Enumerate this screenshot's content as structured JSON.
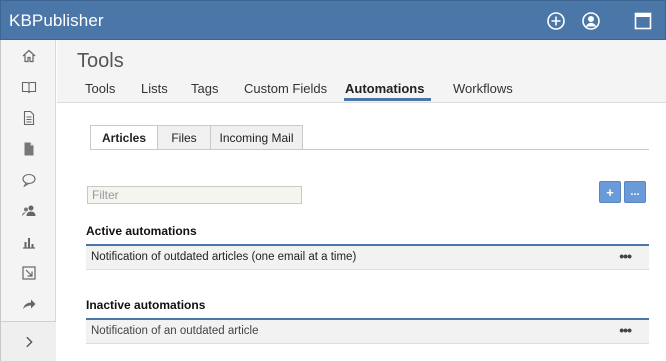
{
  "app": {
    "brand": "KBPublisher",
    "top_icons": [
      "plus-circle-icon",
      "user-circle-icon",
      "window-icon"
    ]
  },
  "sidebar": {
    "items": [
      "home-icon",
      "book-icon",
      "document-icon",
      "file-icon",
      "comments-icon",
      "users-icon",
      "chart-icon",
      "export-icon",
      "share-icon"
    ],
    "expand_icon": "chevron-right-icon"
  },
  "header": {
    "title": "Tools",
    "tabs": [
      {
        "label": "Tools"
      },
      {
        "label": "Lists"
      },
      {
        "label": "Tags"
      },
      {
        "label": "Custom Fields"
      },
      {
        "label": "Automations",
        "active": true
      },
      {
        "label": "Workflows"
      }
    ]
  },
  "subtabs": [
    {
      "label": "Articles",
      "active": true
    },
    {
      "label": "Files"
    },
    {
      "label": "Incoming Mail"
    }
  ],
  "filter": {
    "placeholder": "Filter",
    "value": ""
  },
  "buttons": {
    "add": "+",
    "more": "..."
  },
  "active_section": {
    "title": "Active automations",
    "rows": [
      {
        "text": "Notification of outdated articles (one email at a time)",
        "menu": "•••"
      }
    ]
  },
  "inactive_section": {
    "title": "Inactive automations",
    "rows": [
      {
        "text": "Notification of an outdated article",
        "menu": "•••"
      }
    ]
  },
  "colors": {
    "brand": "#4a76a8",
    "button": "#6a9bd8"
  }
}
